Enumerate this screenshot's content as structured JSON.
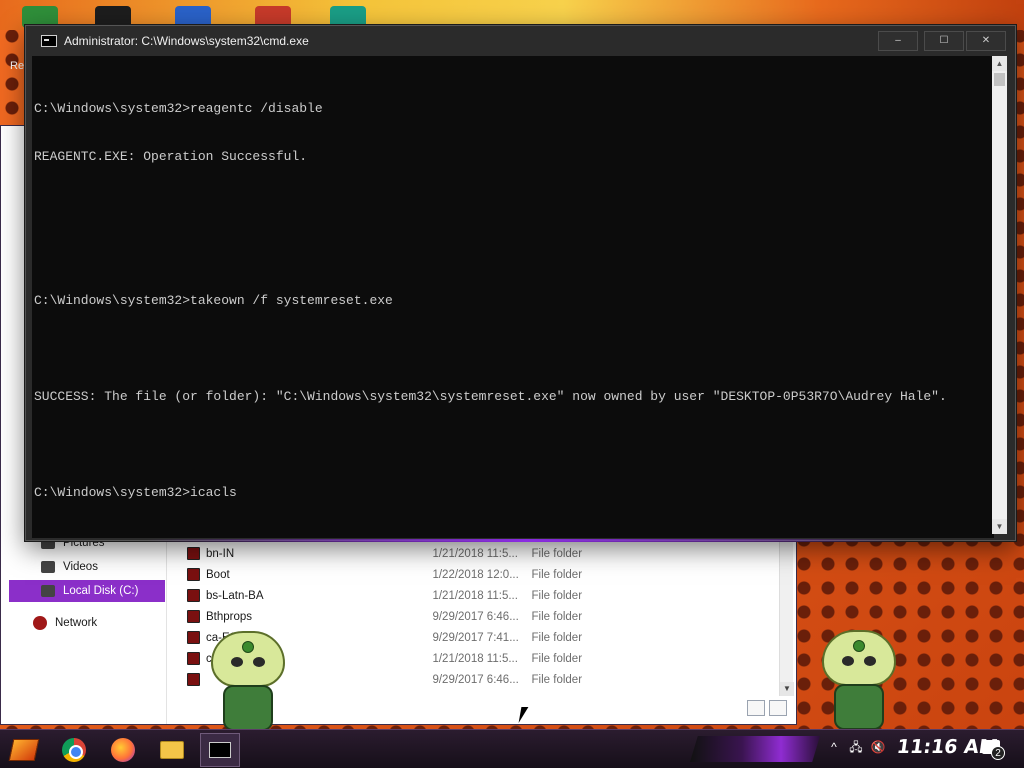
{
  "desktop": {
    "icon_label": "Re"
  },
  "cmd_window": {
    "title": "Administrator: C:\\Windows\\system32\\cmd.exe",
    "minimize": "–",
    "maximize": "☐",
    "close": "✕",
    "lines": [
      "C:\\Windows\\system32>reagentc /disable",
      "REAGENTC.EXE: Operation Successful.",
      "",
      "",
      "C:\\Windows\\system32>takeown /f systemreset.exe",
      "",
      "SUCCESS: The file (or folder): \"C:\\Windows\\system32\\systemreset.exe\" now owned by user \"DESKTOP-0P53R7O\\Audrey Hale\".",
      "",
      "C:\\Windows\\system32>icacls"
    ]
  },
  "explorer": {
    "nav_items": [
      {
        "label": "Pictures"
      },
      {
        "label": "Videos"
      },
      {
        "label": "Local Disk (C:)",
        "selected": true
      },
      {
        "label": "Network"
      }
    ],
    "files": [
      {
        "name": "bn-IN",
        "date": "1/21/2018 11:5...",
        "type": "File folder"
      },
      {
        "name": "Boot",
        "date": "1/22/2018 12:0...",
        "type": "File folder"
      },
      {
        "name": "bs-Latn-BA",
        "date": "1/21/2018 11:5...",
        "type": "File folder"
      },
      {
        "name": "Bthprops",
        "date": "9/29/2017 6:46...",
        "type": "File folder"
      },
      {
        "name": "ca-ES",
        "date": "9/29/2017 7:41...",
        "type": "File folder"
      },
      {
        "name": "ca",
        "date": "1/21/2018 11:5...",
        "type": "File folder"
      },
      {
        "name": "",
        "date": "9/29/2017 6:46...",
        "type": "File folder"
      }
    ]
  },
  "taskbar": {
    "clock": "11:16 AM",
    "notification_count": "2",
    "tray": {
      "chevron": "^",
      "network": "🖧",
      "volume": "🔇"
    }
  },
  "colors": {
    "accent_purple": "#8b2fc9",
    "console_bg": "#0c0c0c",
    "console_fg": "#cccccc"
  }
}
